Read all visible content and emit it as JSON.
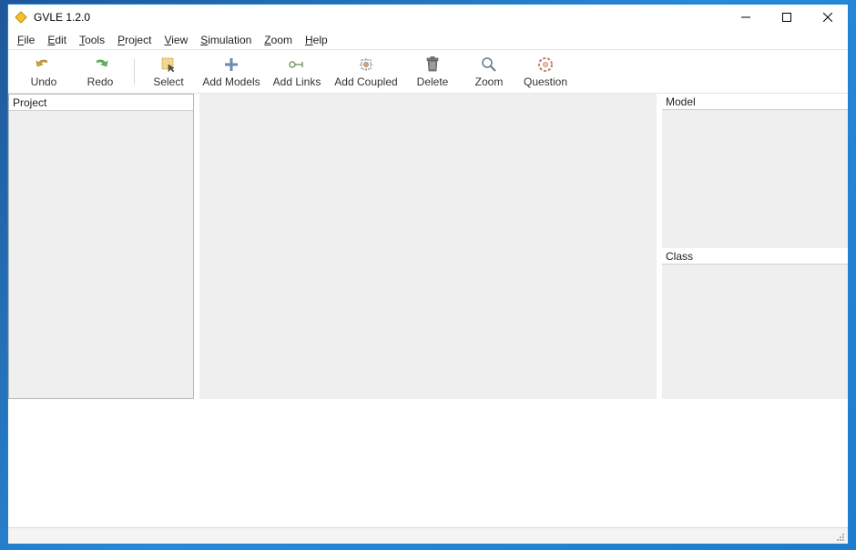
{
  "titlebar": {
    "title": "GVLE 1.2.0"
  },
  "menu": {
    "file": "File",
    "edit": "Edit",
    "tools": "Tools",
    "project": "Project",
    "view": "View",
    "simulation": "Simulation",
    "zoom": "Zoom",
    "help": "Help"
  },
  "toolbar": {
    "undo": "Undo",
    "redo": "Redo",
    "select": "Select",
    "add_models": "Add Models",
    "add_links": "Add Links",
    "add_coupled": "Add Coupled",
    "delete": "Delete",
    "zoom": "Zoom",
    "question": "Question"
  },
  "panels": {
    "project": "Project",
    "model": "Model",
    "class": "Class"
  }
}
